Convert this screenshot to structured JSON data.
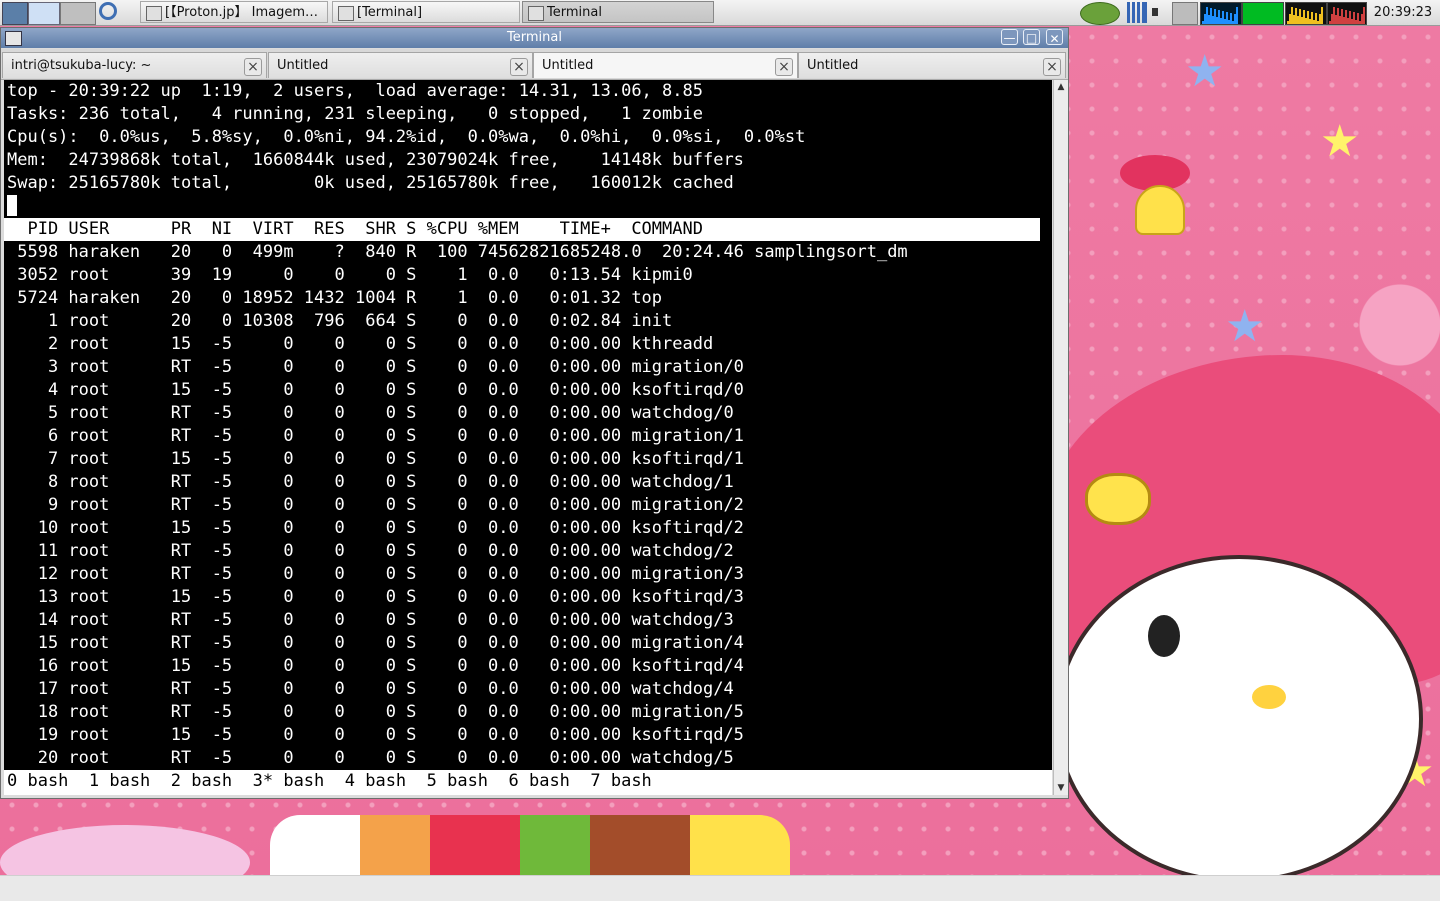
{
  "taskbar": {
    "tasks": [
      {
        "label": "[【Proton.jp】 Imagem…",
        "icon": "browser-icon"
      },
      {
        "label": "[Terminal]",
        "icon": "terminal-icon"
      },
      {
        "label": "Terminal",
        "icon": "terminal-icon"
      }
    ],
    "clock": "20:39:23"
  },
  "window": {
    "title": "Terminal",
    "tabs": [
      {
        "label": "intri@tsukuba-lucy: ~",
        "close_icon": "×"
      },
      {
        "label": "Untitled",
        "close_icon": "×"
      },
      {
        "label": "Untitled",
        "close_icon": "×"
      },
      {
        "label": "Untitled",
        "close_icon": "×"
      }
    ]
  },
  "top": {
    "summary": [
      "top - 20:39:22 up  1:19,  2 users,  load average: 14.31, 13.06, 8.85",
      "Tasks: 236 total,   4 running, 231 sleeping,   0 stopped,   1 zombie",
      "Cpu(s):  0.0%us,  5.8%sy,  0.0%ni, 94.2%id,  0.0%wa,  0.0%hi,  0.0%si,  0.0%st",
      "Mem:  24739868k total,  1660844k used, 23079024k free,    14148k buffers",
      "Swap: 25165780k total,        0k used, 25165780k free,   160012k cached"
    ],
    "header": "  PID USER      PR  NI  VIRT  RES  SHR S %CPU %MEM    TIME+  COMMAND",
    "processes": [
      " 5598 haraken   20   0  499m    ?  840 R  100 74562821685248.0  20:24.46 samplingsort_dm",
      " 3052 root      39  19     0    0    0 S    1  0.0   0:13.54 kipmi0",
      " 5724 haraken   20   0 18952 1432 1004 R    1  0.0   0:01.32 top",
      "    1 root      20   0 10308  796  664 S    0  0.0   0:02.84 init",
      "    2 root      15  -5     0    0    0 S    0  0.0   0:00.00 kthreadd",
      "    3 root      RT  -5     0    0    0 S    0  0.0   0:00.00 migration/0",
      "    4 root      15  -5     0    0    0 S    0  0.0   0:00.00 ksoftirqd/0",
      "    5 root      RT  -5     0    0    0 S    0  0.0   0:00.00 watchdog/0",
      "    6 root      RT  -5     0    0    0 S    0  0.0   0:00.00 migration/1",
      "    7 root      15  -5     0    0    0 S    0  0.0   0:00.00 ksoftirqd/1",
      "    8 root      RT  -5     0    0    0 S    0  0.0   0:00.00 watchdog/1",
      "    9 root      RT  -5     0    0    0 S    0  0.0   0:00.00 migration/2",
      "   10 root      15  -5     0    0    0 S    0  0.0   0:00.00 ksoftirqd/2",
      "   11 root      RT  -5     0    0    0 S    0  0.0   0:00.00 watchdog/2",
      "   12 root      RT  -5     0    0    0 S    0  0.0   0:00.00 migration/3",
      "   13 root      15  -5     0    0    0 S    0  0.0   0:00.00 ksoftirqd/3",
      "   14 root      RT  -5     0    0    0 S    0  0.0   0:00.00 watchdog/3",
      "   15 root      RT  -5     0    0    0 S    0  0.0   0:00.00 migration/4",
      "   16 root      15  -5     0    0    0 S    0  0.0   0:00.00 ksoftirqd/4",
      "   17 root      RT  -5     0    0    0 S    0  0.0   0:00.00 watchdog/4",
      "   18 root      RT  -5     0    0    0 S    0  0.0   0:00.00 migration/5",
      "   19 root      15  -5     0    0    0 S    0  0.0   0:00.00 ksoftirqd/5",
      "   20 root      RT  -5     0    0    0 S    0  0.0   0:00.00 watchdog/5"
    ]
  },
  "screen_status": "0 bash  1 bash  2 bash  3* bash  4 bash  5 bash  6 bash  7 bash",
  "colors": {
    "terminal_bg": "#000000",
    "terminal_fg": "#ffffff",
    "titlebar": "#6f8bb5",
    "desktop_pink": "#ee7aa3"
  }
}
